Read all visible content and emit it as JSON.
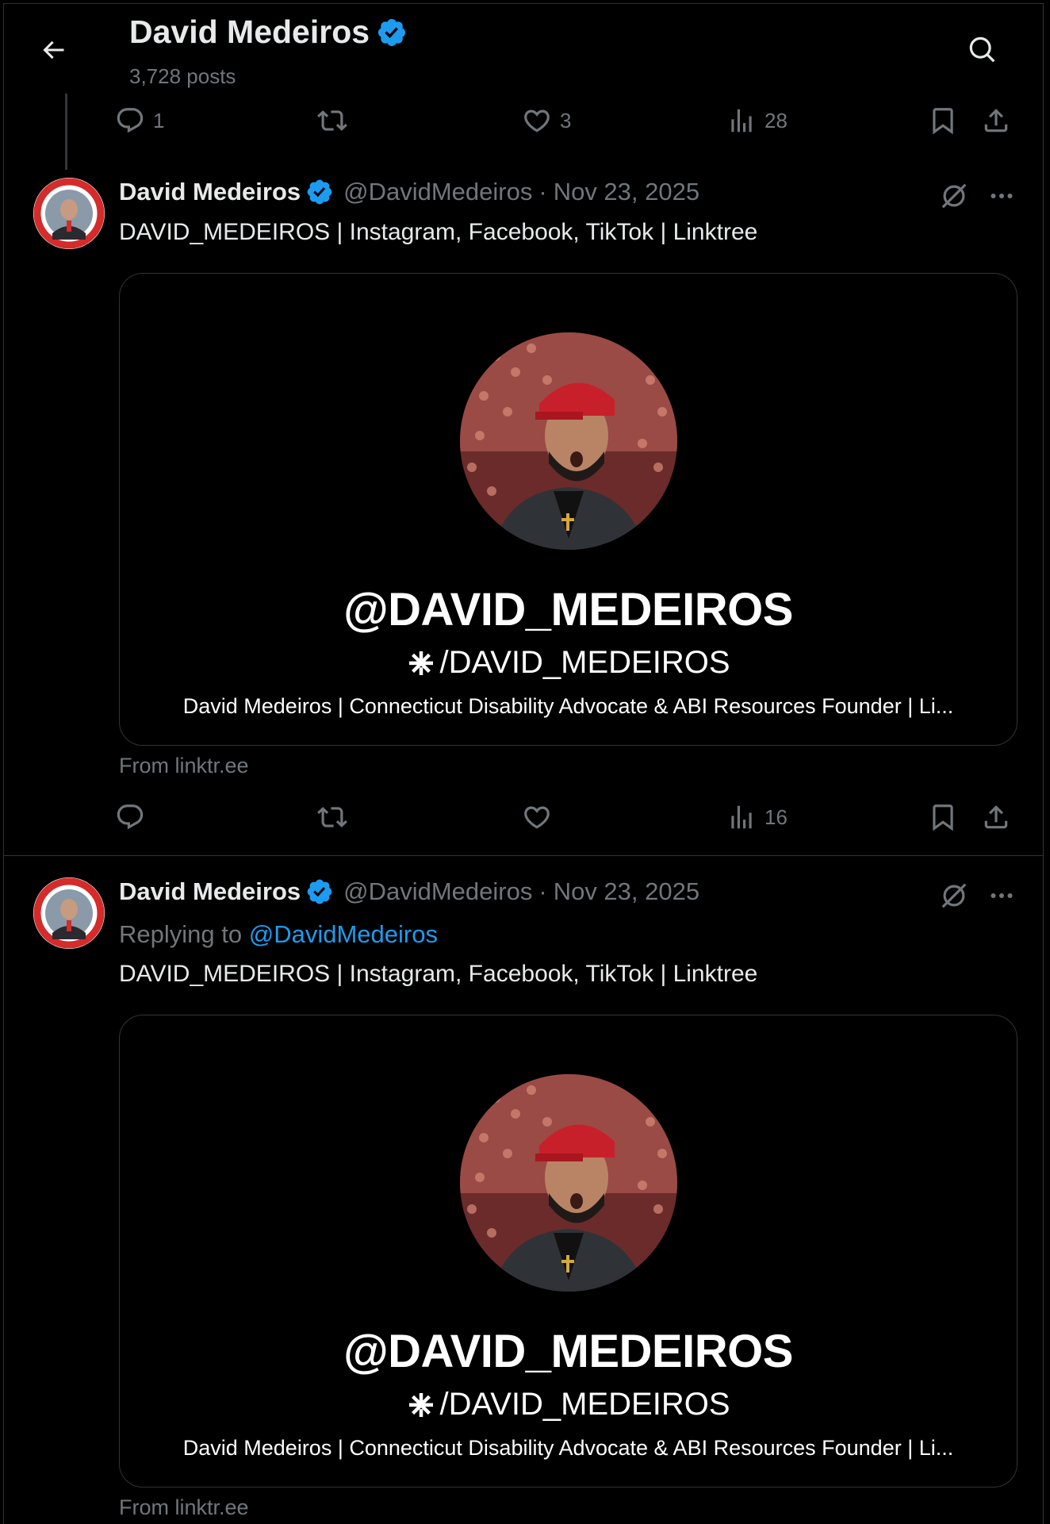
{
  "header": {
    "title": "David Medeiros",
    "posts": "3,728 posts"
  },
  "top_actions": {
    "replies": "1",
    "reposts": "",
    "likes": "3",
    "views": "28"
  },
  "tweets": [
    {
      "name": "David Medeiros",
      "handle": "@DavidMedeiros",
      "sep": "·",
      "date": "Nov 23, 2025",
      "replying_prefix": "",
      "replying_to": "",
      "text": "DAVID_MEDEIROS | Instagram, Facebook, TikTok | Linktree",
      "card": {
        "handle": "@DAVID_MEDEIROS",
        "link": "/DAVID_MEDEIROS",
        "description": "David Medeiros | Connecticut Disability Advocate & ABI Resources Founder | Li..."
      },
      "source": "From linktr.ee",
      "actions": {
        "replies": "",
        "reposts": "",
        "likes": "",
        "views": "16"
      }
    },
    {
      "name": "David Medeiros",
      "handle": "@DavidMedeiros",
      "sep": "·",
      "date": "Nov 23, 2025",
      "replying_prefix": "Replying to ",
      "replying_to": "@DavidMedeiros",
      "text": "DAVID_MEDEIROS | Instagram, Facebook, TikTok | Linktree",
      "card": {
        "handle": "@DAVID_MEDEIROS",
        "link": "/DAVID_MEDEIROS",
        "description": "David Medeiros | Connecticut Disability Advocate & ABI Resources Founder | Li..."
      },
      "source": "From linktr.ee"
    }
  ],
  "colors": {
    "background": "#000000",
    "text": "#e7e9ea",
    "muted": "#71767b",
    "accent": "#1d9bf0",
    "border": "#2f3336"
  },
  "icons": [
    "back-arrow-icon",
    "search-icon",
    "verified-badge-icon",
    "reply-icon",
    "repost-icon",
    "like-icon",
    "views-icon",
    "bookmark-icon",
    "share-icon",
    "grok-icon",
    "more-icon",
    "linktree-icon"
  ]
}
